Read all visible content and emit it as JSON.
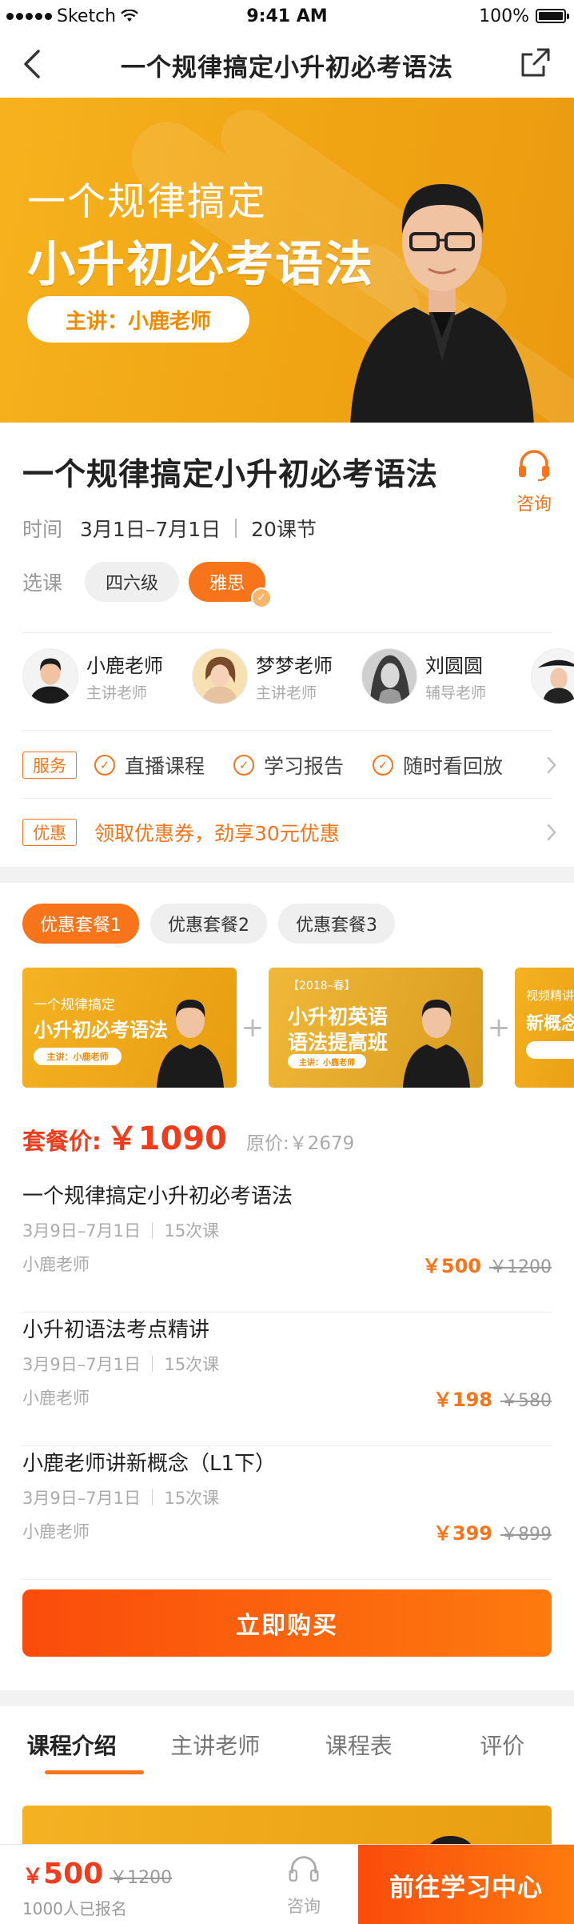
{
  "status_bar": {
    "carrier": "Sketch",
    "time": "9:41 AM",
    "battery": "100%"
  },
  "nav": {
    "title": "一个规律搞定小升初必考语法",
    "back_icon": "chevron-left-icon",
    "share_icon": "share-icon"
  },
  "banner": {
    "line1": "一个规律搞定",
    "line2": "小升初必考语法",
    "pill": "主讲：小鹿老师"
  },
  "course": {
    "title": "一个规律搞定小升初必考语法",
    "consult_label": "咨询",
    "time_label": "时间",
    "time_value": "3月1日–7月1日",
    "lessons": "20课节",
    "select_label": "选课",
    "options": [
      {
        "label": "四六级",
        "selected": false
      },
      {
        "label": "雅思",
        "selected": true
      }
    ]
  },
  "teachers": [
    {
      "name": "小鹿老师",
      "role": "主讲老师"
    },
    {
      "name": "梦梦老师",
      "role": "主讲老师"
    },
    {
      "name": "刘圆圆",
      "role": "辅导老师"
    },
    {
      "name": "",
      "role": ""
    }
  ],
  "service": {
    "tag": "服务",
    "items": [
      "直播课程",
      "学习报告",
      "随时看回放"
    ]
  },
  "promo": {
    "tag": "优惠",
    "text": "领取优惠券，劲享30元优惠"
  },
  "packages": {
    "tabs": [
      {
        "label": "优惠套餐1",
        "active": true
      },
      {
        "label": "优惠套餐2",
        "active": false
      },
      {
        "label": "优惠套餐3",
        "active": false
      }
    ],
    "cards": [
      {
        "small": "一个规律搞定",
        "big": "小升初必考语法",
        "pill": "主讲：小鹿老师"
      },
      {
        "tag": "【2018–春】",
        "big1": "小升初英语",
        "big2": "语法提高班",
        "pill": "主讲：小鹿老师"
      },
      {
        "small": "视频精讲",
        "big": "新概念"
      }
    ],
    "plus": "+",
    "price_label": "套餐价:",
    "price": "￥1090",
    "original": "原价:￥2679",
    "items": [
      {
        "title": "一个规律搞定小升初必考语法",
        "date": "3月9日–7月1日",
        "count": "15次课",
        "teacher": "小鹿老师",
        "price": "￥500",
        "old": "￥1200"
      },
      {
        "title": "小升初语法考点精讲",
        "date": "3月9日–7月1日",
        "count": "15次课",
        "teacher": "小鹿老师",
        "price": "￥198",
        "old": "￥580"
      },
      {
        "title": "小鹿老师讲新概念（L1下）",
        "date": "3月9日–7月1日",
        "count": "15次课",
        "teacher": "小鹿老师",
        "price": "￥399",
        "old": "￥899"
      }
    ],
    "buy_label": "立即购买"
  },
  "detail_tabs": [
    {
      "label": "课程介绍",
      "active": true
    },
    {
      "label": "主讲老师",
      "active": false
    },
    {
      "label": "课程表",
      "active": false
    },
    {
      "label": "评价",
      "active": false
    }
  ],
  "bottom_bar": {
    "price_symbol": "￥",
    "price": "500",
    "old_price": "￥1200",
    "enrolled": "1000人已报名",
    "consult_label": "咨询",
    "go_label": "前往学习中心"
  },
  "colors": {
    "accent": "#f7741a",
    "price_red": "#f03c1a",
    "banner_yellow": "#f2a817"
  }
}
